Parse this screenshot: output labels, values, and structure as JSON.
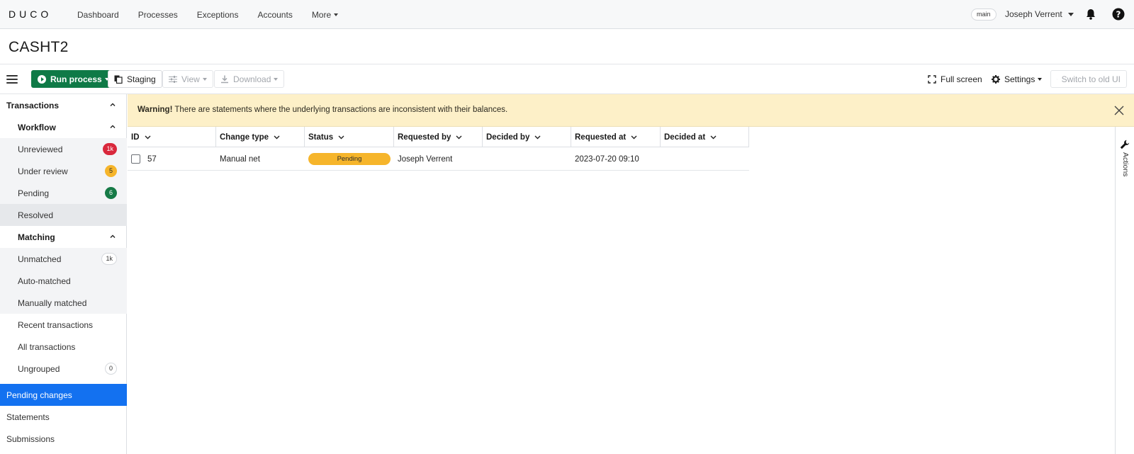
{
  "app": {
    "logo_text": "DUCO",
    "nav": [
      "Dashboard",
      "Processes",
      "Exceptions",
      "Accounts"
    ],
    "nav_more": "More",
    "branch": "main",
    "user_name": "Joseph Verrent"
  },
  "page": {
    "title": "CASHT2"
  },
  "toolbar": {
    "run_process": "Run process",
    "staging": "Staging",
    "view": "View",
    "download": "Download",
    "full_screen": "Full screen",
    "settings": "Settings",
    "switch_ui": "Switch to old UI"
  },
  "sidebar": {
    "transactions": "Transactions",
    "workflow": "Workflow",
    "unreviewed": "Unreviewed",
    "unreviewed_count": "1k",
    "under_review": "Under review",
    "under_review_count": "5",
    "pending": "Pending",
    "pending_count": "6",
    "resolved": "Resolved",
    "matching": "Matching",
    "unmatched": "Unmatched",
    "unmatched_count": "1k",
    "auto_matched": "Auto-matched",
    "manually_matched": "Manually matched",
    "recent_transactions": "Recent transactions",
    "all_transactions": "All transactions",
    "ungrouped": "Ungrouped",
    "ungrouped_count": "0",
    "pending_changes": "Pending changes",
    "statements": "Statements",
    "submissions": "Submissions"
  },
  "warning": {
    "label": "Warning!",
    "message": " There are statements where the underlying transactions are inconsistent with their balances."
  },
  "grid": {
    "columns": [
      "ID",
      "Change type",
      "Status",
      "Requested by",
      "Decided by",
      "Requested at",
      "Decided at"
    ],
    "rows": [
      {
        "id": "57",
        "change_type": "Manual net",
        "status": "Pending",
        "requested_by": "Joseph Verrent",
        "decided_by": "",
        "requested_at": "2023-07-20 09:10",
        "decided_at": ""
      }
    ]
  },
  "actions": {
    "label": "Actions"
  },
  "colors": {
    "primary_green": "#0f7a47",
    "active_blue": "#1371f0",
    "warning_bg": "#fdf0c8",
    "pending_yellow": "#f6b52b",
    "badge_red": "#d9283c"
  }
}
